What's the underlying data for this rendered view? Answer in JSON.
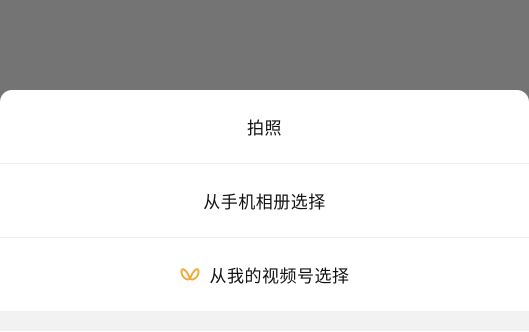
{
  "sheet": {
    "options": [
      {
        "label": "拍照"
      },
      {
        "label": "从手机相册选择"
      },
      {
        "label": "从我的视频号选择",
        "icon": "channels-butterfly-icon"
      }
    ]
  },
  "colors": {
    "backdrop": "#747474",
    "sheet": "#ffffff",
    "divider": "#ececec",
    "channels_icon": "#f4a93a",
    "text": "#111111"
  }
}
